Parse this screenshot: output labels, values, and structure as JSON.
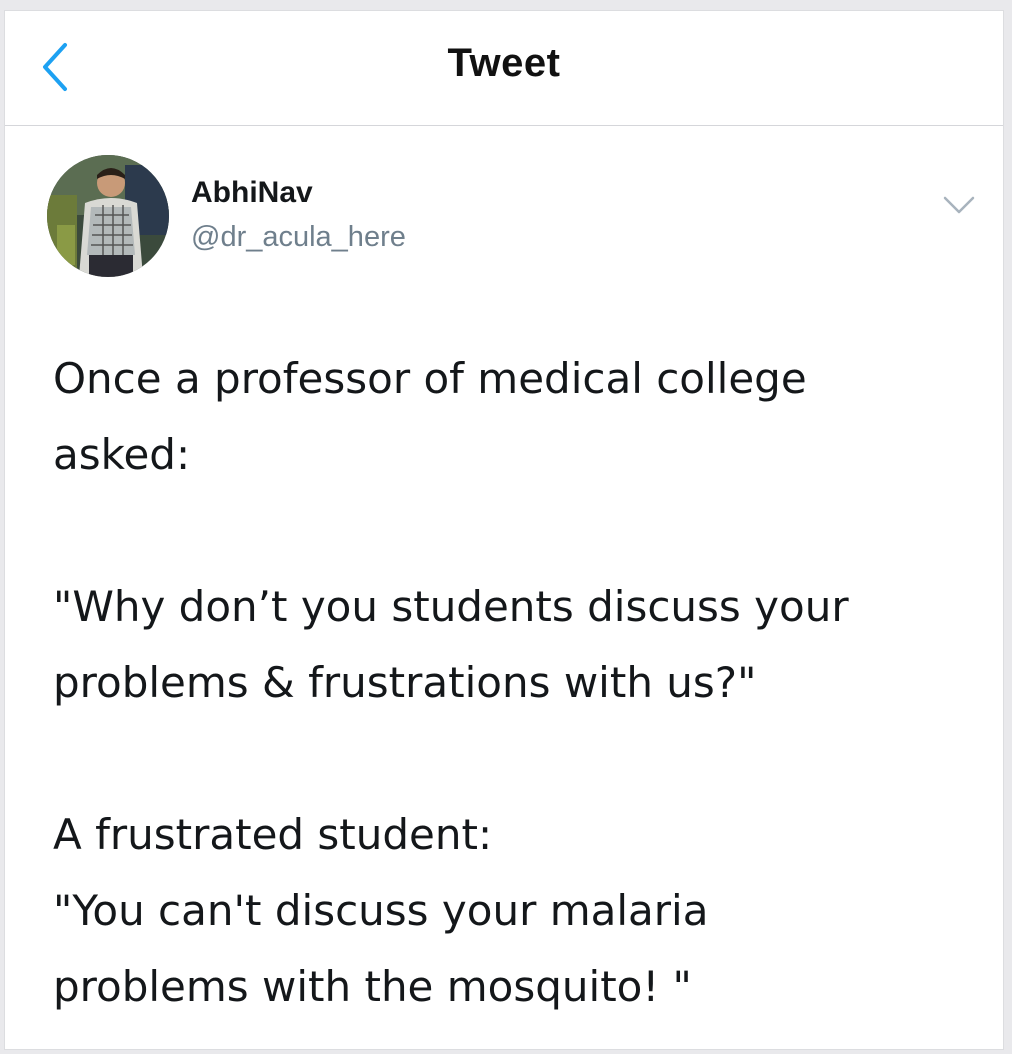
{
  "nav": {
    "title": "Tweet",
    "back_icon": "chevron-left-icon"
  },
  "tweet": {
    "author": {
      "display_name": "AbhiNav",
      "handle": "@dr_acula_here",
      "avatar_icon": "profile-photo"
    },
    "menu_icon": "chevron-down-icon",
    "paragraphs": [
      [
        "Once a professor of medical college",
        "asked:"
      ],
      [
        "\"Why don’t you students discuss your",
        "problems & frustrations with us?\""
      ],
      [
        "A frustrated student:",
        "\"You can't discuss your malaria",
        "problems with the mosquito! \""
      ]
    ]
  },
  "colors": {
    "accent": "#1da1f2",
    "text": "#14171a",
    "muted": "#6f7f8c",
    "divider": "#d5d6da"
  }
}
